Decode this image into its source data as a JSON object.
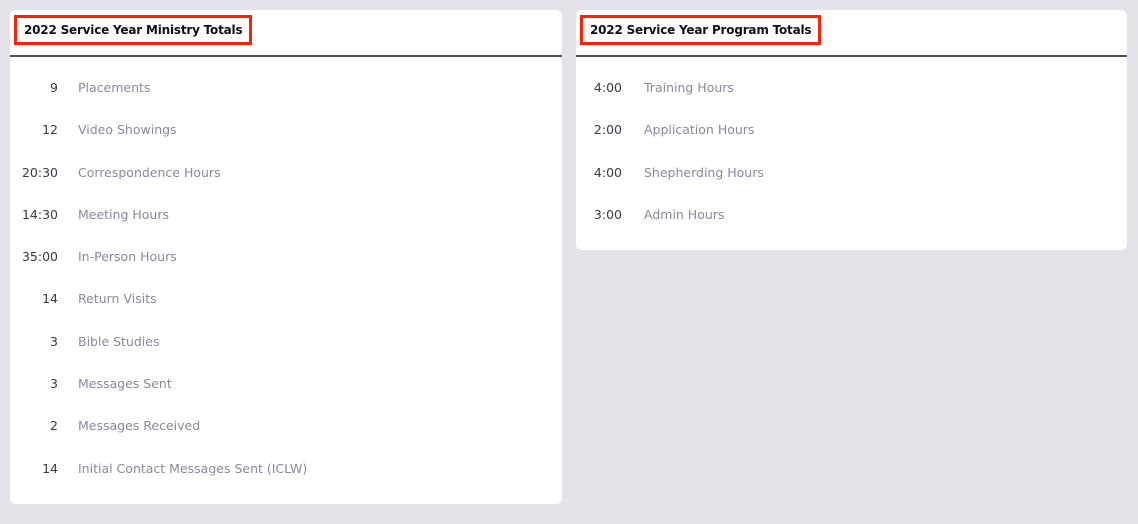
{
  "ministry": {
    "title": "2022 Service Year Ministry Totals",
    "rows": [
      {
        "value": "9",
        "label": "Placements"
      },
      {
        "value": "12",
        "label": "Video Showings"
      },
      {
        "value": "20:30",
        "label": "Correspondence Hours"
      },
      {
        "value": "14:30",
        "label": "Meeting Hours"
      },
      {
        "value": "35:00",
        "label": "In-Person Hours"
      },
      {
        "value": "14",
        "label": "Return Visits"
      },
      {
        "value": "3",
        "label": "Bible Studies"
      },
      {
        "value": "3",
        "label": "Messages Sent"
      },
      {
        "value": "2",
        "label": "Messages Received"
      },
      {
        "value": "14",
        "label": "Initial Contact Messages Sent (ICLW)"
      }
    ]
  },
  "program": {
    "title": "2022 Service Year Program Totals",
    "rows": [
      {
        "value": "4:00",
        "label": "Training Hours"
      },
      {
        "value": "2:00",
        "label": "Application Hours"
      },
      {
        "value": "4:00",
        "label": "Shepherding Hours"
      },
      {
        "value": "3:00",
        "label": "Admin Hours"
      }
    ]
  },
  "colors": {
    "background": "#e4e3e9",
    "card": "#ffffff",
    "highlight_border": "#f2270a",
    "divider": "#4d4b5c",
    "value_text": "#3b3a47",
    "label_text": "#8a889b"
  }
}
